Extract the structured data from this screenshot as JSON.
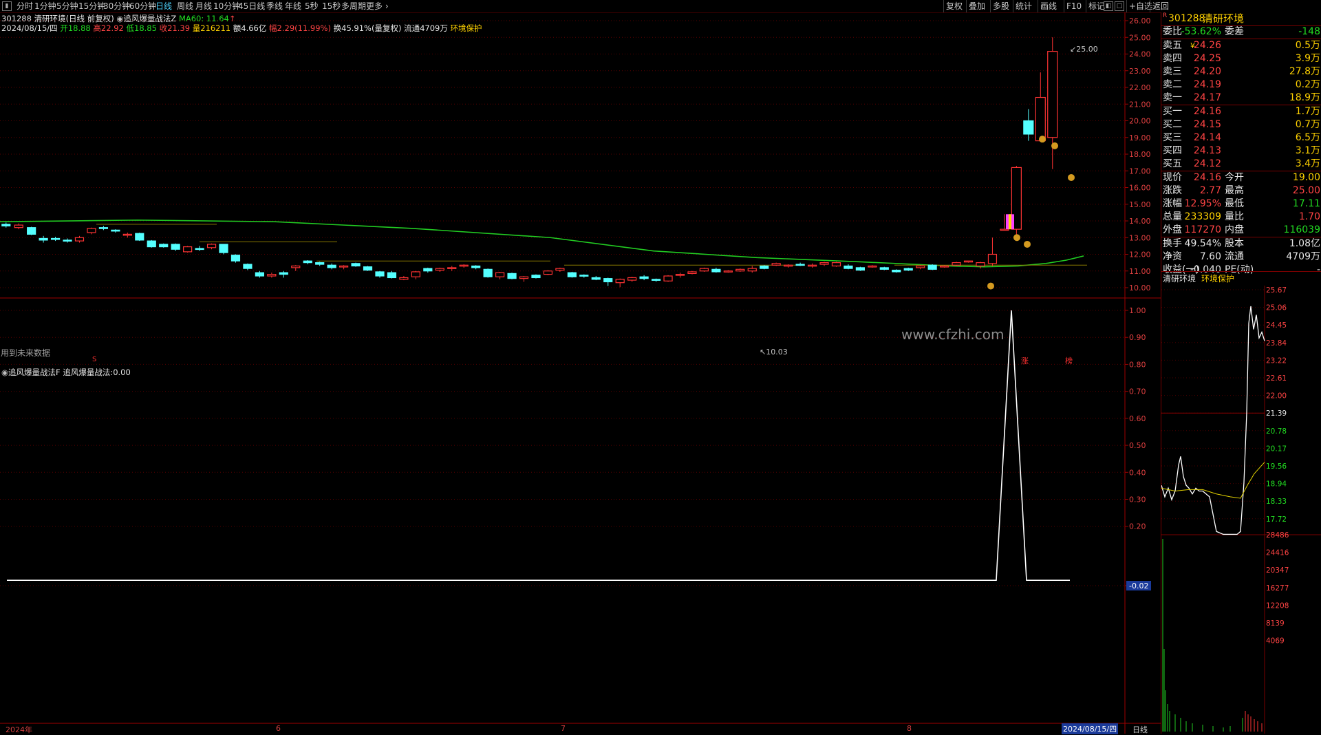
{
  "toolbar": {
    "menu_icon": "menu-icon",
    "periods": [
      "分时",
      "1分钟",
      "5分钟",
      "15分钟",
      "30分钟",
      "60分钟",
      "日线",
      "周线",
      "月线",
      "10分钟",
      "45日线",
      "季线",
      "年线",
      "5秒",
      "15秒",
      "多周期",
      "更多"
    ],
    "active_period": "日线",
    "right_items": [
      "复权",
      "叠加",
      "多股",
      "统计",
      "画线",
      "F10",
      "标记",
      "+自选",
      "返回"
    ]
  },
  "header": {
    "code": "301288",
    "name": "清研环境",
    "mode": "(日线 前复权)",
    "indicator": "追风爆量战法Z",
    "ma_label": "MA60: 11.64",
    "ma_arrow": "↑"
  },
  "info": {
    "date": "2024/08/15/四",
    "open_label": "开",
    "open": "18.88",
    "high_label": "高",
    "high": "22.92",
    "low_label": "低",
    "low": "18.85",
    "close_label": "收",
    "close": "21.39",
    "vol_label": "量",
    "vol": "216211",
    "amount": "额4.66亿",
    "change_label": "幅",
    "change": "2.29(11.99%)",
    "turnover": "换45.91%(量复权)",
    "float": "流通4709万",
    "concept": "环境保护"
  },
  "main_chart": {
    "y_ticks": [
      "26.00",
      "25.00",
      "24.00",
      "23.00",
      "22.00",
      "21.00",
      "20.00",
      "19.00",
      "18.00",
      "17.00",
      "16.00",
      "15.00",
      "14.00",
      "13.00",
      "12.00",
      "11.00",
      "10.00"
    ],
    "high_marker": "25.00",
    "low_marker": "10.03",
    "watermark": "www.cfzhi.com",
    "future_data_note": "用到未来数据",
    "signal_zhang": "涨",
    "signal_bang": "榜",
    "signal_s": "S"
  },
  "sub_chart": {
    "title": "追风爆量战法F",
    "label": "追风爆量战法:",
    "value": "0.00",
    "y_ticks": [
      "1.00",
      "0.90",
      "0.80",
      "0.70",
      "0.60",
      "0.50",
      "0.40",
      "0.30",
      "0.20",
      "-0.02"
    ]
  },
  "x_axis": {
    "labels": [
      "2024年",
      "6",
      "7",
      "8"
    ],
    "current_date": "2024/08/15/四",
    "period_tab": "日线"
  },
  "quote": {
    "badge": "R",
    "code": "301288",
    "name": "清研环境",
    "weibi_label": "委比",
    "weibi": "-53.62%",
    "weicha_label": "委差",
    "weicha": "-148",
    "asks": [
      {
        "label": "卖五",
        "price": "24.26",
        "vol": "0.5万",
        "mark": "¥"
      },
      {
        "label": "卖四",
        "price": "24.25",
        "vol": "3.9万",
        "mark": ""
      },
      {
        "label": "卖三",
        "price": "24.20",
        "vol": "27.8万",
        "mark": ""
      },
      {
        "label": "卖二",
        "price": "24.19",
        "vol": "0.2万",
        "mark": ""
      },
      {
        "label": "卖一",
        "price": "24.17",
        "vol": "18.9万",
        "mark": ""
      }
    ],
    "bids": [
      {
        "label": "买一",
        "price": "24.16",
        "vol": "1.7万"
      },
      {
        "label": "买二",
        "price": "24.15",
        "vol": "0.7万"
      },
      {
        "label": "买三",
        "price": "24.14",
        "vol": "6.5万"
      },
      {
        "label": "买四",
        "price": "24.13",
        "vol": "3.1万"
      },
      {
        "label": "买五",
        "price": "24.12",
        "vol": "3.4万"
      }
    ],
    "stats": [
      {
        "l1": "现价",
        "v1": "24.16",
        "l2": "今开",
        "v2": "19.00"
      },
      {
        "l1": "涨跌",
        "v1": "2.77",
        "l2": "最高",
        "v2": "25.00"
      },
      {
        "l1": "涨幅",
        "v1": "12.95%",
        "l2": "最低",
        "v2": "17.11"
      },
      {
        "l1": "总量",
        "v1": "233309",
        "l2": "量比",
        "v2": "1.70"
      },
      {
        "l1": "外盘",
        "v1": "117270",
        "l2": "内盘",
        "v2": "116039"
      }
    ],
    "stats2": [
      {
        "l1": "换手",
        "v1": "49.54%",
        "l2": "股本",
        "v2": "1.08亿"
      },
      {
        "l1": "净资",
        "v1": "7.60",
        "l2": "流通",
        "v2": "4709万"
      },
      {
        "l1": "收益(一)",
        "v1": "-0.040",
        "l2": "PE(动)",
        "v2": "-"
      }
    ]
  },
  "mini": {
    "name": "清研环境",
    "concept": "环境保护",
    "price_ticks": [
      "25.67",
      "25.06",
      "24.45",
      "23.84",
      "23.22",
      "22.61",
      "22.00",
      "21.39",
      "20.78",
      "20.17",
      "19.56",
      "18.94",
      "18.33",
      "17.72"
    ],
    "vol_ticks": [
      "28486",
      "24416",
      "20347",
      "16277",
      "12208",
      "8139",
      "4069"
    ]
  },
  "colors": {
    "up": "#ff3333",
    "down": "#54ffff",
    "ma": "#22cc22",
    "grid": "#7a0000",
    "axis": "#a00000"
  }
}
